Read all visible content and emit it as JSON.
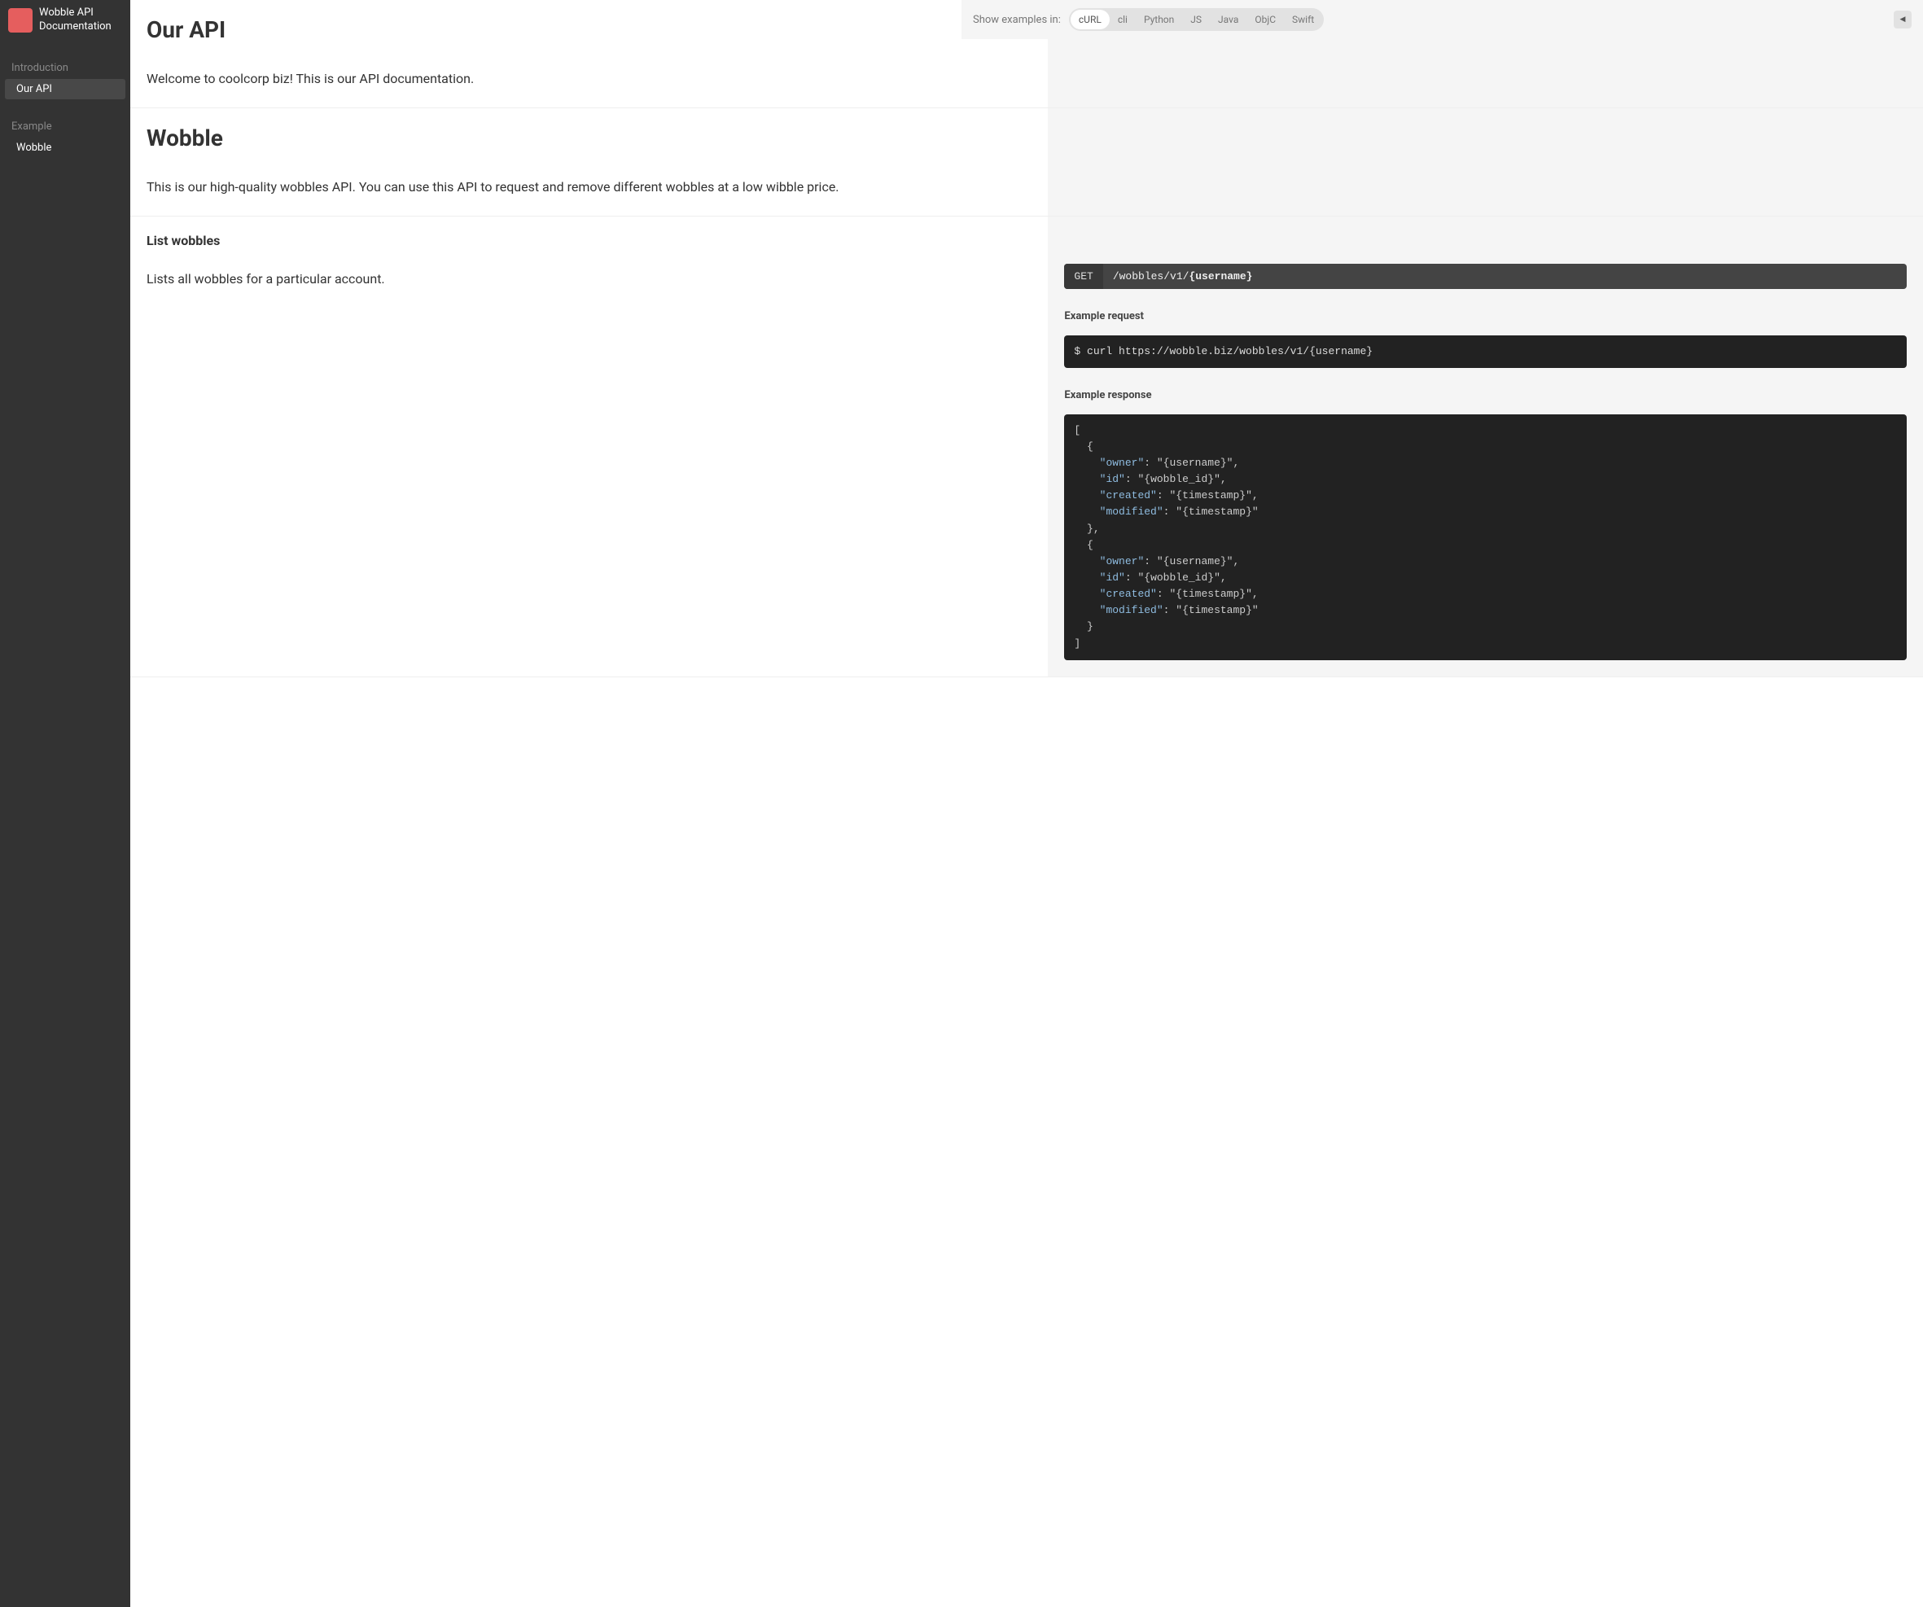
{
  "site": {
    "title": "Wobble API Documentation"
  },
  "sidebar": {
    "groups": [
      {
        "label": "Introduction",
        "items": [
          {
            "label": "Our API",
            "active": true
          }
        ]
      },
      {
        "label": "Example",
        "items": [
          {
            "label": "Wobble",
            "active": false
          }
        ]
      }
    ]
  },
  "topbar": {
    "examples_label": "Show examples in:",
    "languages": [
      "cURL",
      "cli",
      "Python",
      "JS",
      "Java",
      "ObjC",
      "Swift"
    ],
    "active_language": "cURL"
  },
  "sections": {
    "our_api": {
      "title": "Our API",
      "body": "Welcome to coolcorp biz! This is our API documentation."
    },
    "wobble": {
      "title": "Wobble",
      "body": "This is our high-quality wobbles API. You can use this API to request and remove different wobbles at a low wibble price."
    },
    "list_wobbles": {
      "title": "List wobbles",
      "body": "Lists all wobbles for a particular account.",
      "endpoint": {
        "method": "GET",
        "path_prefix": "/wobbles/v1/",
        "path_param": "{username}"
      },
      "example_request_label": "Example request",
      "example_request": "$ curl https://wobble.biz/wobbles/v1/{username}",
      "example_response_label": "Example response",
      "example_response_tokens": [
        {
          "t": "[",
          "c": "punct"
        },
        {
          "t": "\n",
          "c": ""
        },
        {
          "t": "  {",
          "c": "punct"
        },
        {
          "t": "\n",
          "c": ""
        },
        {
          "t": "    ",
          "c": ""
        },
        {
          "t": "\"owner\"",
          "c": "key"
        },
        {
          "t": ": ",
          "c": "punct"
        },
        {
          "t": "\"{username}\"",
          "c": "str"
        },
        {
          "t": ",",
          "c": "punct"
        },
        {
          "t": "\n",
          "c": ""
        },
        {
          "t": "    ",
          "c": ""
        },
        {
          "t": "\"id\"",
          "c": "key"
        },
        {
          "t": ": ",
          "c": "punct"
        },
        {
          "t": "\"{wobble_id}\"",
          "c": "str"
        },
        {
          "t": ",",
          "c": "punct"
        },
        {
          "t": "\n",
          "c": ""
        },
        {
          "t": "    ",
          "c": ""
        },
        {
          "t": "\"created\"",
          "c": "key"
        },
        {
          "t": ": ",
          "c": "punct"
        },
        {
          "t": "\"{timestamp}\"",
          "c": "str"
        },
        {
          "t": ",",
          "c": "punct"
        },
        {
          "t": "\n",
          "c": ""
        },
        {
          "t": "    ",
          "c": ""
        },
        {
          "t": "\"modified\"",
          "c": "key"
        },
        {
          "t": ": ",
          "c": "punct"
        },
        {
          "t": "\"{timestamp}\"",
          "c": "str"
        },
        {
          "t": "\n",
          "c": ""
        },
        {
          "t": "  },",
          "c": "punct"
        },
        {
          "t": "\n",
          "c": ""
        },
        {
          "t": "  {",
          "c": "punct"
        },
        {
          "t": "\n",
          "c": ""
        },
        {
          "t": "    ",
          "c": ""
        },
        {
          "t": "\"owner\"",
          "c": "key"
        },
        {
          "t": ": ",
          "c": "punct"
        },
        {
          "t": "\"{username}\"",
          "c": "str"
        },
        {
          "t": ",",
          "c": "punct"
        },
        {
          "t": "\n",
          "c": ""
        },
        {
          "t": "    ",
          "c": ""
        },
        {
          "t": "\"id\"",
          "c": "key"
        },
        {
          "t": ": ",
          "c": "punct"
        },
        {
          "t": "\"{wobble_id}\"",
          "c": "str"
        },
        {
          "t": ",",
          "c": "punct"
        },
        {
          "t": "\n",
          "c": ""
        },
        {
          "t": "    ",
          "c": ""
        },
        {
          "t": "\"created\"",
          "c": "key"
        },
        {
          "t": ": ",
          "c": "punct"
        },
        {
          "t": "\"{timestamp}\"",
          "c": "str"
        },
        {
          "t": ",",
          "c": "punct"
        },
        {
          "t": "\n",
          "c": ""
        },
        {
          "t": "    ",
          "c": ""
        },
        {
          "t": "\"modified\"",
          "c": "key"
        },
        {
          "t": ": ",
          "c": "punct"
        },
        {
          "t": "\"{timestamp}\"",
          "c": "str"
        },
        {
          "t": "\n",
          "c": ""
        },
        {
          "t": "  }",
          "c": "punct"
        },
        {
          "t": "\n",
          "c": ""
        },
        {
          "t": "]",
          "c": "punct"
        }
      ]
    }
  }
}
